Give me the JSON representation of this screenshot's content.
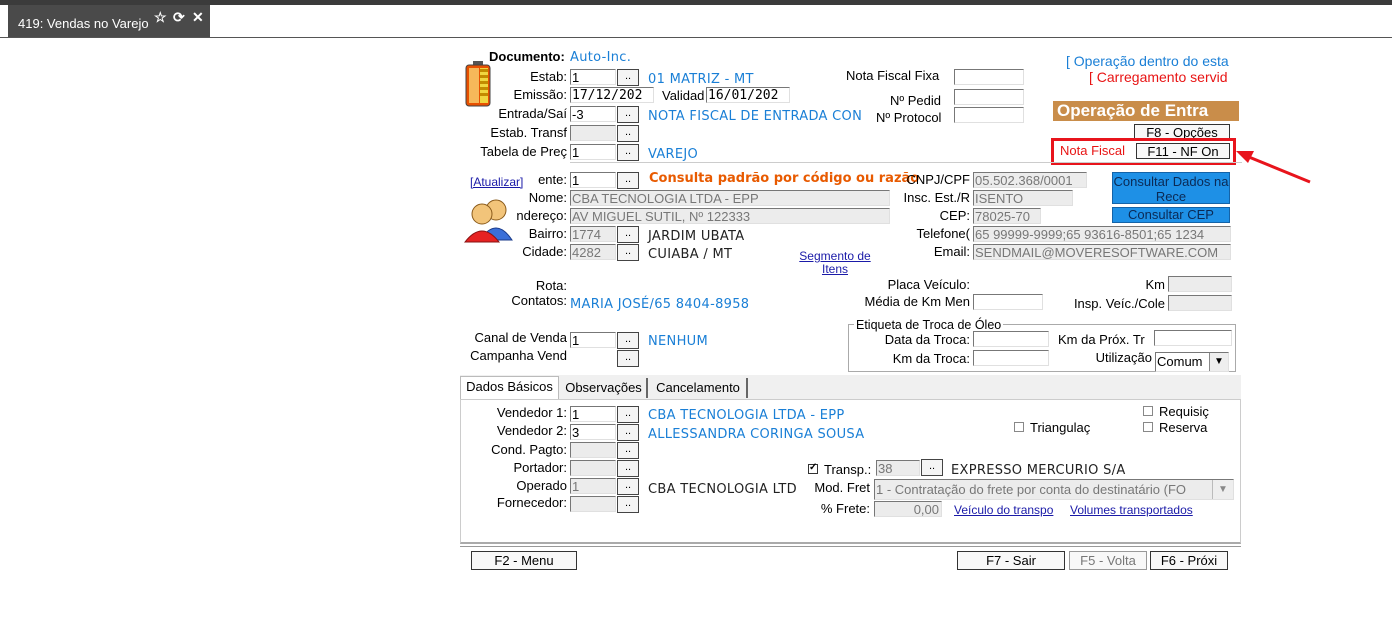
{
  "window": {
    "tab_title": "419: Vendas no Varejo",
    "tab_icons": [
      "star-icon",
      "refresh-icon",
      "close-icon"
    ]
  },
  "doc": {
    "documento_label": "Documento:",
    "documento_value": "Auto-Inc.",
    "estab_label": "Estab:",
    "estab_value": "1",
    "estab_name": "01 MATRIZ - MT",
    "emissao_label": "Emissão:",
    "emissao_value": "17/12/202",
    "validade_label": "Validad",
    "validade_value": "16/01/202",
    "entrada_label": "Entrada/Saí",
    "entrada_value": "-3",
    "entrada_name": "NOTA FISCAL DE ENTRADA CON",
    "estab_transf_label": "Estab. Transf",
    "tabela_label": "Tabela de Preç",
    "tabela_value": "1",
    "tabela_name": "VAREJO",
    "nota_fixa_label": "Nota  Fiscal Fixa",
    "pedido_label": "Nº Pedid",
    "protocolo_label": "Nº Protocol"
  },
  "status": {
    "operacao_line": "[ Operação dentro do esta",
    "carregamento_line": "[ Carregamento servid",
    "operacao_banner": "Operação de Entra",
    "f8_button": "F8 - Opções",
    "nota_fiscal_label": "Nota Fiscal",
    "f11_button": "F11 - NF On"
  },
  "client": {
    "atualizar_link": "[Atualizar]",
    "cliente_label": "ente:",
    "cliente_value": "1",
    "cliente_hint": "Consulta padrão por código ou razão",
    "nome_label": "Nome:",
    "nome_value": "CBA TECNOLOGIA LTDA - EPP",
    "endereco_label": "ndereço:",
    "endereco_value": "AV MIGUEL SUTIL, Nº 122333",
    "bairro_label": "Bairro:",
    "bairro_value": "1774",
    "bairro_name": "JARDIM UBATA",
    "cidade_label": "Cidade:",
    "cidade_value": "4282",
    "cidade_name": "CUIABA / MT",
    "segmento_link": "Segmento de Itens",
    "cnpj_label": "CNPJ/CPF",
    "cnpj_value": "05.502.368/0001",
    "insc_label": "Insc. Est./R",
    "insc_value": "ISENTO",
    "cep_label": "CEP:",
    "cep_value": "78025-70",
    "telefone_label": "Telefone(",
    "telefone_value": "65 99999-9999;65 93616-8501;65 1234",
    "email_label": "Email:",
    "email_value": "SENDMAIL@MOVERESOFTWARE.COM",
    "consultar_receita_button": "Consultar Dados na Rece",
    "consultar_cep_button": "Consultar CEP"
  },
  "route": {
    "rota_label": "Rota:",
    "contatos_label": "Contatos:",
    "contatos_value": "MARIA JOSÉ/65 8404-8958",
    "placa_label": "Placa Veículo:",
    "km_label": "Km",
    "media_label": "Média de Km Men",
    "insp_label": "Insp. Veíc./Cole"
  },
  "canal": {
    "canal_label": "Canal de Venda",
    "canal_value": "1",
    "canal_name": "NENHUM",
    "campanha_label": "Campanha Vend"
  },
  "oleo": {
    "title": "Etiqueta de Troca de Óleo",
    "data_troca_label": "Data da Troca:",
    "km_troca_label": "Km da Troca:",
    "km_prox_label": "Km da Próx. Tr",
    "utilizacao_label": "Utilização",
    "utilizacao_value": "Comum"
  },
  "tabs": {
    "dados_basicos": "Dados Básicos",
    "observacoes": "Observações",
    "cancelamento": "Cancelamento"
  },
  "basic": {
    "vendedor1_label": "Vendedor 1:",
    "vendedor1_value": "1",
    "vendedor1_name": "CBA TECNOLOGIA LTDA - EPP",
    "vendedor2_label": "Vendedor 2:",
    "vendedor2_value": "3",
    "vendedor2_name": "ALLESSANDRA CORINGA SOUSA",
    "cond_pagto_label": "Cond. Pagto:",
    "portador_label": "Portador:",
    "operador_label": "Operado",
    "operador_value": "1",
    "operador_name": "CBA TECNOLOGIA LTD",
    "fornecedor_label": "Fornecedor:",
    "triangulacao_label": "Triangulaç",
    "requisicao_label": "Requisiç",
    "reserva_label": "Reserva",
    "transp_label": "Transp.:",
    "transp_value": "38",
    "transp_name": "EXPRESSO MERCURIO S/A",
    "mod_frete_label": "Mod. Fret",
    "mod_frete_value": "1 - Contratação do frete por conta do destinatário (FO",
    "perc_frete_label": "% Frete:",
    "perc_frete_value": "0,00",
    "veiculo_link": "Veículo do transpo",
    "volumes_link": "Volumes transportados"
  },
  "footer": {
    "menu": "F2 - Menu",
    "sair": "F7 - Sair",
    "volta": "F5 - Volta",
    "proxi": "F6 - Próxi"
  },
  "colors": {
    "accent_blue": "#1a7fd6",
    "accent_orange": "#e85a00",
    "banner": "#c98d4a",
    "highlight_red": "#e8141c"
  }
}
